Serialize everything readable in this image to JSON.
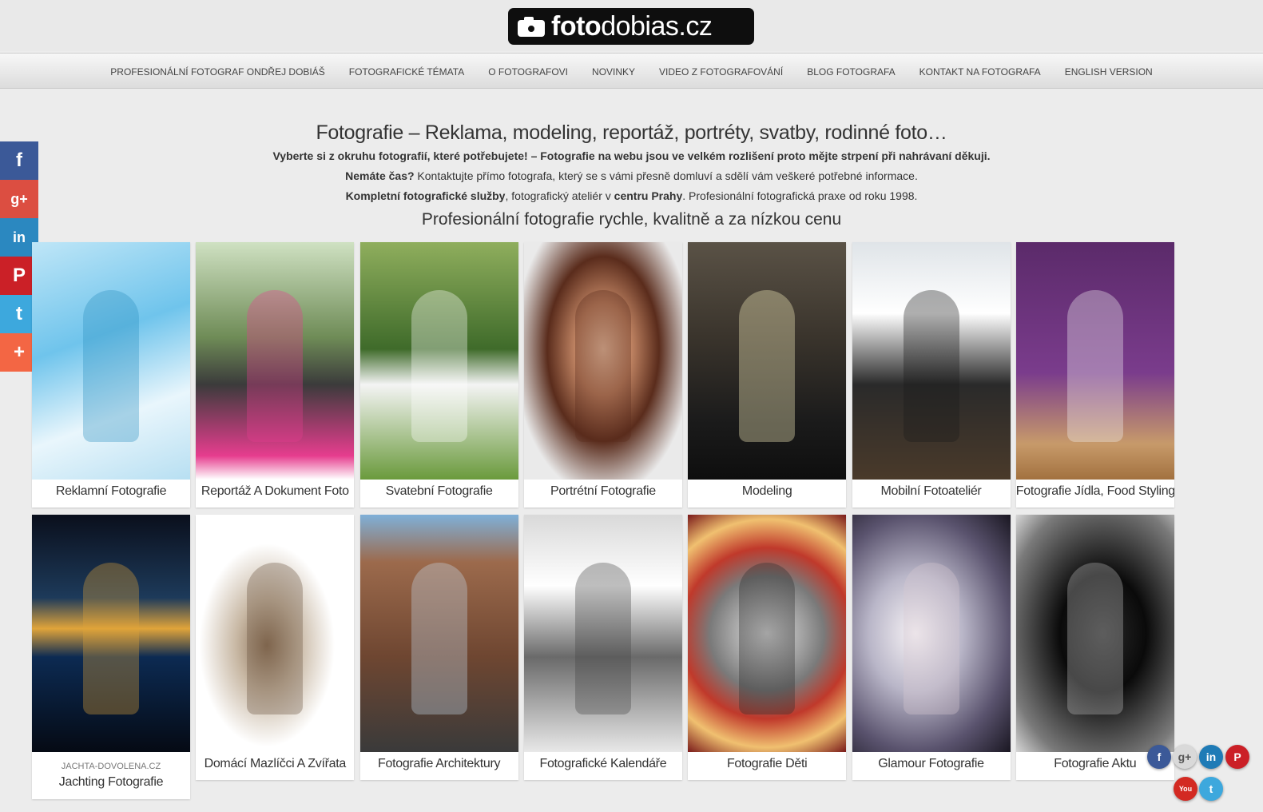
{
  "logo": {
    "bold": "foto",
    "light": "dobias.cz"
  },
  "nav": [
    "PROFESIONÁLNÍ FOTOGRAF ONDŘEJ DOBIÁŠ",
    "FOTOGRAFICKÉ TÉMATA",
    "O FOTOGRAFOVI",
    "NOVINKY",
    "VIDEO Z FOTOGRAFOVÁNÍ",
    "BLOG FOTOGRAFA",
    "KONTAKT NA FOTOGRAFA",
    "ENGLISH VERSION"
  ],
  "intro": {
    "title": "Fotografie – Reklama, modeling, reportáž, portréty, svatby, rodinné foto…",
    "line1_bold": "Vyberte si z okruhu fotografií, které potřebujete! – Fotografie na webu jsou ve velkém rozlišení proto mějte strpení při nahrávaní děkuji.",
    "line2_bold": "Nemáte čas?",
    "line2_rest": " Kontaktujte přímo fotografa, který se s vámi přesně domluví a sdělí vám veškeré potřebné informace.",
    "line3_bold1": "Kompletní fotografické služby",
    "line3_mid": ", fotografický ateliér v ",
    "line3_bold2": "centru Prahy",
    "line3_rest": ". Profesionální fotografická praxe od roku 1998.",
    "subtitle": "Profesionální fotografie rychle, kvalitně a za nízkou cenu"
  },
  "share": [
    {
      "name": "facebook",
      "glyph": "f",
      "color": "#3b5998"
    },
    {
      "name": "googleplus",
      "glyph": "g+",
      "color": "#dc4e41"
    },
    {
      "name": "linkedin",
      "glyph": "in",
      "color": "#2b88c0"
    },
    {
      "name": "pinterest",
      "glyph": "P",
      "color": "#cb2027"
    },
    {
      "name": "twitter",
      "glyph": "t",
      "color": "#3da8dd"
    },
    {
      "name": "more",
      "glyph": "+",
      "color": "#f36644"
    }
  ],
  "cards": [
    {
      "caption": "Reklamní Fotografie",
      "bg": "linear-gradient(160deg,#bfe6f7 0%,#6fc4ec 40%,#e9f6fc 70%,#b7dff2 100%)",
      "accent": "#2a8fbf"
    },
    {
      "caption": "Reportáž A Dokument Foto",
      "bg": "linear-gradient(180deg,#cfe1c2 0%,#6f8c57 40%,#3b3b3b 60%,#e63d8e 90%,#ffffff 100%)",
      "accent": "#e63d8e"
    },
    {
      "caption": "Svatební Fotografie",
      "bg": "linear-gradient(180deg,#8fae5d 0%,#3f6b2a 45%,#f4f4f4 60%,#6a9a3c 100%)",
      "accent": "#ffffff"
    },
    {
      "caption": "Portrétní Fotografie",
      "bg": "radial-gradient(ellipse at 50% 45%,#f2c7a8 0%,#c08463 25%,#5a2c1c 50%,#eaeaea 80%)",
      "accent": "#5a2c1c"
    },
    {
      "caption": "Modeling",
      "bg": "linear-gradient(180deg,#5a5246 0%,#3a342c 40%,#1b1b1b 75%,#0e0e0e 100%)",
      "accent": "#fff6c2"
    },
    {
      "caption": "Mobilní Fotoateliér",
      "bg": "linear-gradient(180deg,#dfe4e8 0%,#ffffff 30%,#2a2a2a 60%,#4a3a2a 100%)",
      "accent": "#1a1a1a"
    },
    {
      "caption": "Fotografie Jídla, Food Styling",
      "bg": "linear-gradient(180deg,#5b2a6a 0%,#7a3c8c 55%,#c79a6a 85%,#a2713f 100%)",
      "accent": "#f4f4f4"
    },
    {
      "caption": "Jachting Fotografie",
      "sub": "JACHTA-DOVOLENA.CZ",
      "bg": "linear-gradient(180deg,#0a0f1c 0%,#1d3a5a 35%,#e0a43a 48%,#0c2a52 60%,#050a14 100%)",
      "accent": "#e0a43a"
    },
    {
      "caption": "Domácí Mazlíčci A Zvířata",
      "bg": "radial-gradient(ellipse at 45% 55%,#8a6f55 0%,#c8b8a4 25%,#ffffff 55%)",
      "accent": "#6b5240"
    },
    {
      "caption": "Fotografie Architektury",
      "bg": "linear-gradient(180deg,#7fb0d8 0%,#9c6a4c 20%,#6e4631 60%,#3a3a3a 100%)",
      "accent": "#c7d9ea"
    },
    {
      "caption": "Fotografické Kalendáře",
      "bg": "linear-gradient(180deg,#d9d9d9 0%,#ffffff 30%,#6a6a6a 60%,#e8e8e8 100%)",
      "accent": "#444444"
    },
    {
      "caption": "Fotografie Děti",
      "bg": "radial-gradient(circle at 50% 50%,#e6e6e6 0%,#7a7a7a 40%,#c0392b 60%,#f0c070 80%,#7a1a1a 100%)",
      "accent": "#2b2b2b"
    },
    {
      "caption": "Glamour Fotografie",
      "bg": "radial-gradient(ellipse at 40% 50%,#f7f3f6 0%,#b9b6c8 35%,#5a536e 70%,#1a1722 100%)",
      "accent": "#d8c9d2"
    },
    {
      "caption": "Fotografie Aktu",
      "bg": "radial-gradient(ellipse at 55% 50%,#2a2a2a 0%,#0a0a0a 35%,#7a7a7a 80%,#d6d6d6 100%)",
      "accent": "#bdbdbd"
    }
  ],
  "social_bottom": [
    {
      "name": "facebook",
      "glyph": "f",
      "color": "#3b5998"
    },
    {
      "name": "googleplus",
      "glyph": "g+",
      "color": "#d9d9d9"
    },
    {
      "name": "linkedin",
      "glyph": "in",
      "color": "#1f7bb6"
    },
    {
      "name": "pinterest",
      "glyph": "P",
      "color": "#cb2027"
    },
    {
      "name": "youtube",
      "glyph": "You",
      "color": "#d32a22"
    },
    {
      "name": "twitter",
      "glyph": "t",
      "color": "#3da8dd"
    }
  ]
}
